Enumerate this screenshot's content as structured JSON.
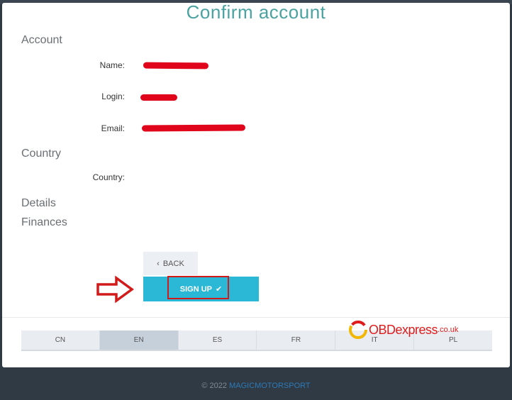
{
  "page": {
    "title": "Confirm account"
  },
  "sections": {
    "account": "Account",
    "country": "Country",
    "details": "Details",
    "finances": "Finances"
  },
  "fields": {
    "name_label": "Name:",
    "login_label": "Login:",
    "email_label": "Email:",
    "country_label": "Country:",
    "country_value": ""
  },
  "buttons": {
    "back_label": "BACK",
    "back_icon": "chevron-left-icon",
    "signup_label": "SIGN UP",
    "signup_icon": "checkmark-icon"
  },
  "languages": [
    {
      "code": "CN",
      "active": false
    },
    {
      "code": "EN",
      "active": true
    },
    {
      "code": "ES",
      "active": false
    },
    {
      "code": "FR",
      "active": false
    },
    {
      "code": "IT",
      "active": false
    },
    {
      "code": "PL",
      "active": false
    }
  ],
  "watermark": {
    "text": "OBDexpress",
    "domain": ".co.uk"
  },
  "footer": {
    "copyright": "© 2022 ",
    "brand": "MAGICMOTORSPORT"
  },
  "colors": {
    "title": "#4aa3a0",
    "signup_button": "#2bb8d6",
    "redaction": "#e0051b",
    "active_language": "#c5d0da",
    "footer_bg": "#2f3a44"
  }
}
